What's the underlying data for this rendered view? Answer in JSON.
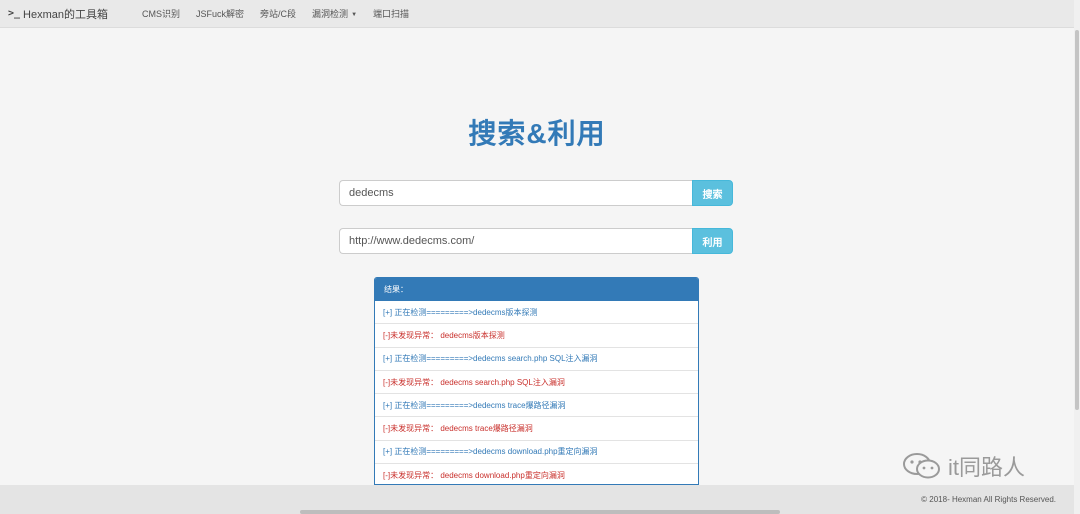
{
  "nav": {
    "brand": "Hexman的工具箱",
    "items": [
      "CMS识别",
      "JSFuck解密",
      "旁站/C段",
      "漏洞检测",
      "端口扫描"
    ]
  },
  "main": {
    "title": "搜索&利用",
    "search": {
      "value": "dedecms",
      "button": "搜索"
    },
    "exploit": {
      "value": "http://www.dedecms.com/",
      "button": "利用"
    }
  },
  "results": {
    "heading": "结果：",
    "rows": [
      {
        "text": "[+] 正在检测=========>dedecms版本探测",
        "kind": "info"
      },
      {
        "text": "[-]未发现异常： dedecms版本探测",
        "kind": "warn"
      },
      {
        "text": "[+] 正在检测=========>dedecms search.php SQL注入漏洞",
        "kind": "info"
      },
      {
        "text": "[-]未发现异常： dedecms search.php SQL注入漏洞",
        "kind": "warn"
      },
      {
        "text": "[+] 正在检测=========>dedecms trace爆路径漏洞",
        "kind": "info"
      },
      {
        "text": "[-]未发现异常： dedecms trace爆路径漏洞",
        "kind": "warn"
      },
      {
        "text": "[+] 正在检测=========>dedecms download.php重定向漏洞",
        "kind": "info"
      },
      {
        "text": "[-]未发现异常： dedecms download.php重定向漏洞",
        "kind": "warn"
      }
    ]
  },
  "footer": {
    "copyright": "© 2018- Hexman All Rights Reserved."
  },
  "watermark": {
    "text": "it同路人",
    "icon": "wechat-icon"
  },
  "colors": {
    "primary": "#337ab7",
    "info": "#5bc0de",
    "warn": "#c9302c"
  }
}
